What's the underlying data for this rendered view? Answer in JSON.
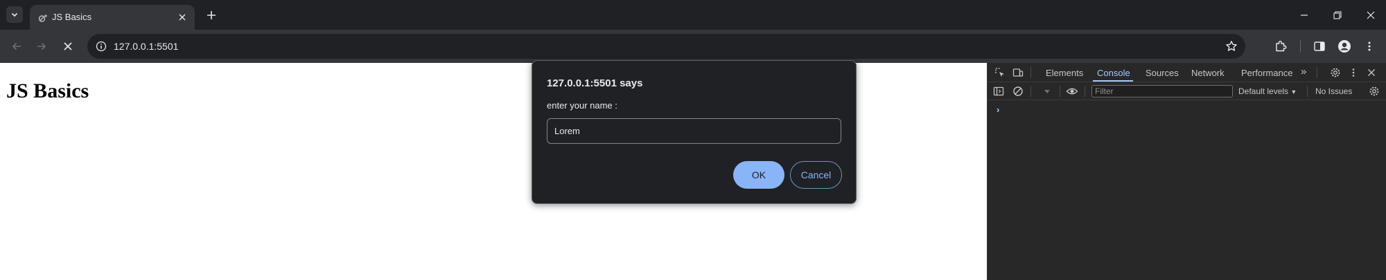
{
  "browser": {
    "tab": {
      "title": "JS Basics"
    },
    "address_bar": {
      "url": "127.0.0.1:5501"
    }
  },
  "page": {
    "heading": "JS Basics"
  },
  "dialog": {
    "title": "127.0.0.1:5501 says",
    "message": "enter your name :",
    "input_value": "Lorem",
    "ok_label": "OK",
    "cancel_label": "Cancel"
  },
  "devtools": {
    "tabs": [
      {
        "label": "Elements",
        "active": false
      },
      {
        "label": "Console",
        "active": true
      },
      {
        "label": "Sources",
        "active": false
      },
      {
        "label": "Network",
        "active": false
      },
      {
        "label": "Performance",
        "active": false
      }
    ],
    "more_tabs": "»",
    "filter_placeholder": "Filter",
    "levels_label": "Default levels",
    "issues_label": "No Issues",
    "prompt": "›"
  },
  "colors": {
    "accent": "#8ab4f8",
    "devtools_active": "#a8c7fa",
    "chrome_dark": "#202124",
    "toolbar": "#35363a"
  }
}
